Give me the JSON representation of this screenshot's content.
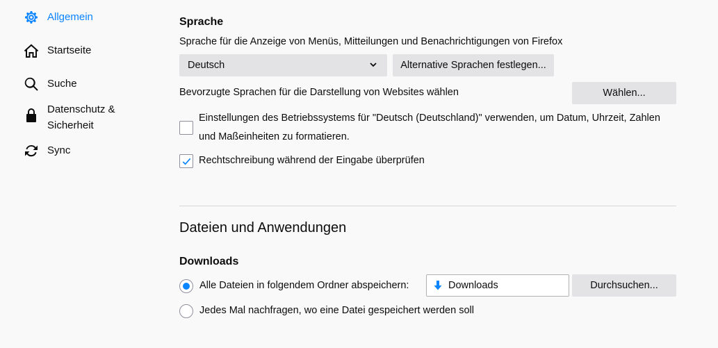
{
  "sidebar": {
    "items": [
      {
        "label": "Allgemein",
        "icon": "gear-icon",
        "active": true
      },
      {
        "label": "Startseite",
        "icon": "home-icon",
        "active": false
      },
      {
        "label": "Suche",
        "icon": "search-icon",
        "active": false
      },
      {
        "label": "Datenschutz & Sicherheit",
        "icon": "lock-icon",
        "active": false
      },
      {
        "label": "Sync",
        "icon": "sync-icon",
        "active": false
      }
    ]
  },
  "language": {
    "heading": "Sprache",
    "description": "Sprache für die Anzeige von Menüs, Mitteilungen und Benachrichtigungen von Firefox",
    "select_value": "Deutsch",
    "alt_languages_button": "Alternative Sprachen festlegen...",
    "preferred_label": "Bevorzugte Sprachen für die Darstellung von Websites wählen",
    "choose_button": "Wählen...",
    "os_settings_checkbox_line1": "Einstellungen des Betriebssystems für \"Deutsch (Deutschland)\" verwenden, um Datum, Uhrzeit, Zahlen",
    "os_settings_checkbox_line2": "und Maßeinheiten zu formatieren.",
    "os_settings_checked": false,
    "spellcheck_checkbox": "Rechtschreibung während der Eingabe überprüfen",
    "spellcheck_checked": true
  },
  "files": {
    "title": "Dateien und Anwendungen",
    "downloads_heading": "Downloads",
    "save_all_radio": "Alle Dateien in folgendem Ordner abspeichern:",
    "save_all_selected": true,
    "folder_value": "Downloads",
    "browse_button": "Durchsuchen...",
    "ask_radio": "Jedes Mal nachfragen, wo eine Datei gespeichert werden soll",
    "ask_selected": false
  },
  "colors": {
    "accent": "#0a84ff",
    "background": "#f9f9fa",
    "button": "#e3e3e5"
  }
}
